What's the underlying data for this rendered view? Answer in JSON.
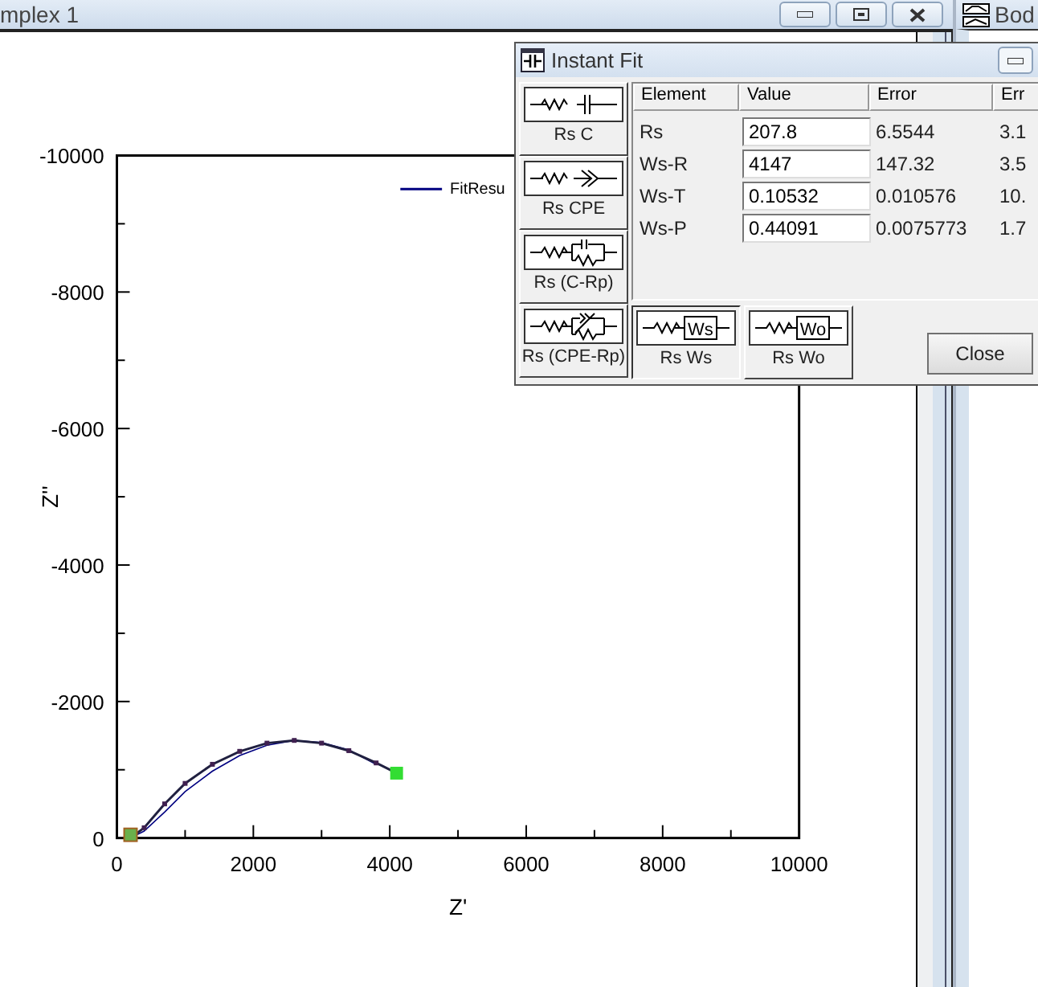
{
  "main_window": {
    "title": "mplex 1"
  },
  "side_window": {
    "title": "Bod"
  },
  "chart": {
    "chart_data": {
      "type": "line",
      "xlabel": "Z'",
      "ylabel": "Z''",
      "xlim": [
        0,
        10000
      ],
      "ylim": [
        0,
        -10000
      ],
      "xticks": [
        0,
        2000,
        4000,
        6000,
        8000,
        10000
      ],
      "yticks": [
        -10000,
        -8000,
        -6000,
        -4000,
        -2000,
        0
      ],
      "x": [
        200,
        400,
        700,
        1000,
        1400,
        1800,
        2200,
        2600,
        3000,
        3400,
        3800,
        4100
      ],
      "series": [
        {
          "name": "FitResu",
          "color": "#000080",
          "values": [
            0,
            -100,
            -380,
            -680,
            -980,
            -1210,
            -1360,
            -1430,
            -1400,
            -1290,
            -1080,
            null
          ]
        },
        {
          "color": "#202040",
          "marker": "square",
          "values": [
            0,
            -150,
            -500,
            -800,
            -1080,
            -1270,
            -1390,
            -1430,
            -1390,
            -1280,
            -1100,
            -950
          ]
        }
      ]
    }
  },
  "dialog": {
    "title": "Instant Fit",
    "models": [
      {
        "label": "Rs C",
        "kind": "c",
        "selected": false
      },
      {
        "label": "Rs CPE",
        "kind": "cpe",
        "selected": false
      },
      {
        "label": "Rs (C-Rp)",
        "kind": "c-rp",
        "selected": false
      },
      {
        "label": "Rs (CPE-Rp)",
        "kind": "cpe-rp",
        "selected": false
      },
      {
        "label": "Rs Ws",
        "kind": "box",
        "symbol": "Ws",
        "selected": true
      },
      {
        "label": "Rs Wo",
        "kind": "box",
        "symbol": "Wo",
        "selected": false
      }
    ],
    "table": {
      "columns": [
        "Element",
        "Value",
        "Error",
        "Err"
      ],
      "rows": [
        {
          "element": "Rs",
          "value": "207.8",
          "error": "6.5544",
          "column_4": "3.1"
        },
        {
          "element": "Ws-R",
          "value": "4147",
          "error": "147.32",
          "column_4": "3.5"
        },
        {
          "element": "Ws-T",
          "value": "0.10532",
          "error": "0.010576",
          "column_4": "10."
        },
        {
          "element": "Ws-P",
          "value": "0.44091",
          "error": "0.0075773",
          "column_4": "1.7"
        }
      ]
    },
    "close_button": "Close"
  }
}
